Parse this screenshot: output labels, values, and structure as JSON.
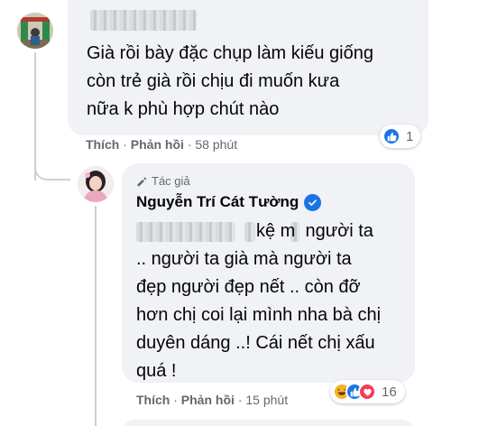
{
  "comment1": {
    "text": "Già rồi bày đặc chụp làm kiếu giống\ncòn trẻ già rồi chịu đi muốn kưa\nnữa k phù hợp chút nào",
    "like_label": "Thích",
    "reply_label": "Phản hồi",
    "time": "58 phút",
    "reaction_count": "1"
  },
  "comment2": {
    "author_tag": "Tác giả",
    "author_name": "Nguyễn Trí Cát Tường",
    "text_first_line_tail": "kệ m  người ta",
    "text_rest": ".. người ta già mà người ta\nđẹp người đẹp nết .. còn đỡ\nhơn chị coi lại mình nha bà chị\nduyên dáng ..! Cái nết chị xấu\nquá !",
    "like_label": "Thích",
    "reply_label": "Phản hồi",
    "time": "15 phút",
    "reaction_count": "16"
  },
  "separator": "·",
  "colors": {
    "bubble": "#f0f2f5",
    "like_blue": "#1b74e4",
    "love_red": "#f33e58",
    "haha_yellow": "#f7b125",
    "meta_gray": "#65676b"
  }
}
